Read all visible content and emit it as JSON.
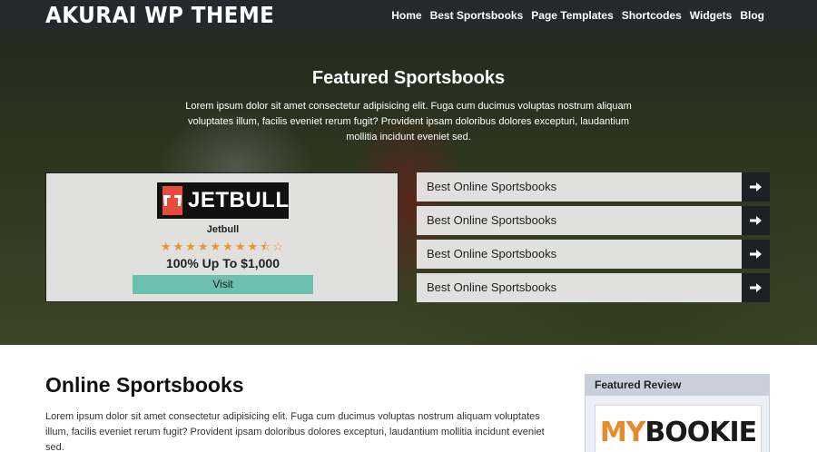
{
  "header": {
    "logo": "AKURAI WP THEME",
    "nav": [
      "Home",
      "Best Sportsbooks",
      "Page Templates",
      "Shortcodes",
      "Widgets",
      "Blog"
    ]
  },
  "hero": {
    "title": "Featured Sportsbooks",
    "text": "Lorem ipsum dolor sit amet consectetur adipisicing elit. Fuga cum ducimus voluptas nostrum aliquam voluptates illum, facilis eveniet rerum fugit? Provident ipsam doloribus dolores excepturi, laudantium mollitia incidunt eveniet sed.",
    "featured": {
      "logo_text": "JETBULL",
      "name": "Jetbull",
      "rating": 8.5,
      "rating_max": 10,
      "stars": "★★★★★★★★⯪☆",
      "offer": "100% Up To $1,000",
      "button": "Visit",
      "accent": "#6dbfb0",
      "logo_color": "#e64b3b"
    },
    "list": [
      {
        "label": "Best Online Sportsbooks",
        "icon": "arrow-right-icon"
      },
      {
        "label": "Best Online Sportsbooks",
        "icon": "arrow-right-icon"
      },
      {
        "label": "Best Online Sportsbooks",
        "icon": "arrow-right-icon"
      },
      {
        "label": "Best Online Sportsbooks",
        "icon": "arrow-right-icon"
      }
    ]
  },
  "content": {
    "title": "Online Sportsbooks",
    "text": "Lorem ipsum dolor sit amet consectetur adipisicing elit. Fuga cum ducimus voluptas nostrum aliquam voluptates illum, facilis eveniet rerum fugit? Provident ipsam doloribus dolores excepturi, laudantium mollitia incidunt eveniet sed."
  },
  "sidebar": {
    "widget_title": "Featured Review",
    "logo_my": "MY",
    "logo_bookie": "BOOKIE"
  }
}
